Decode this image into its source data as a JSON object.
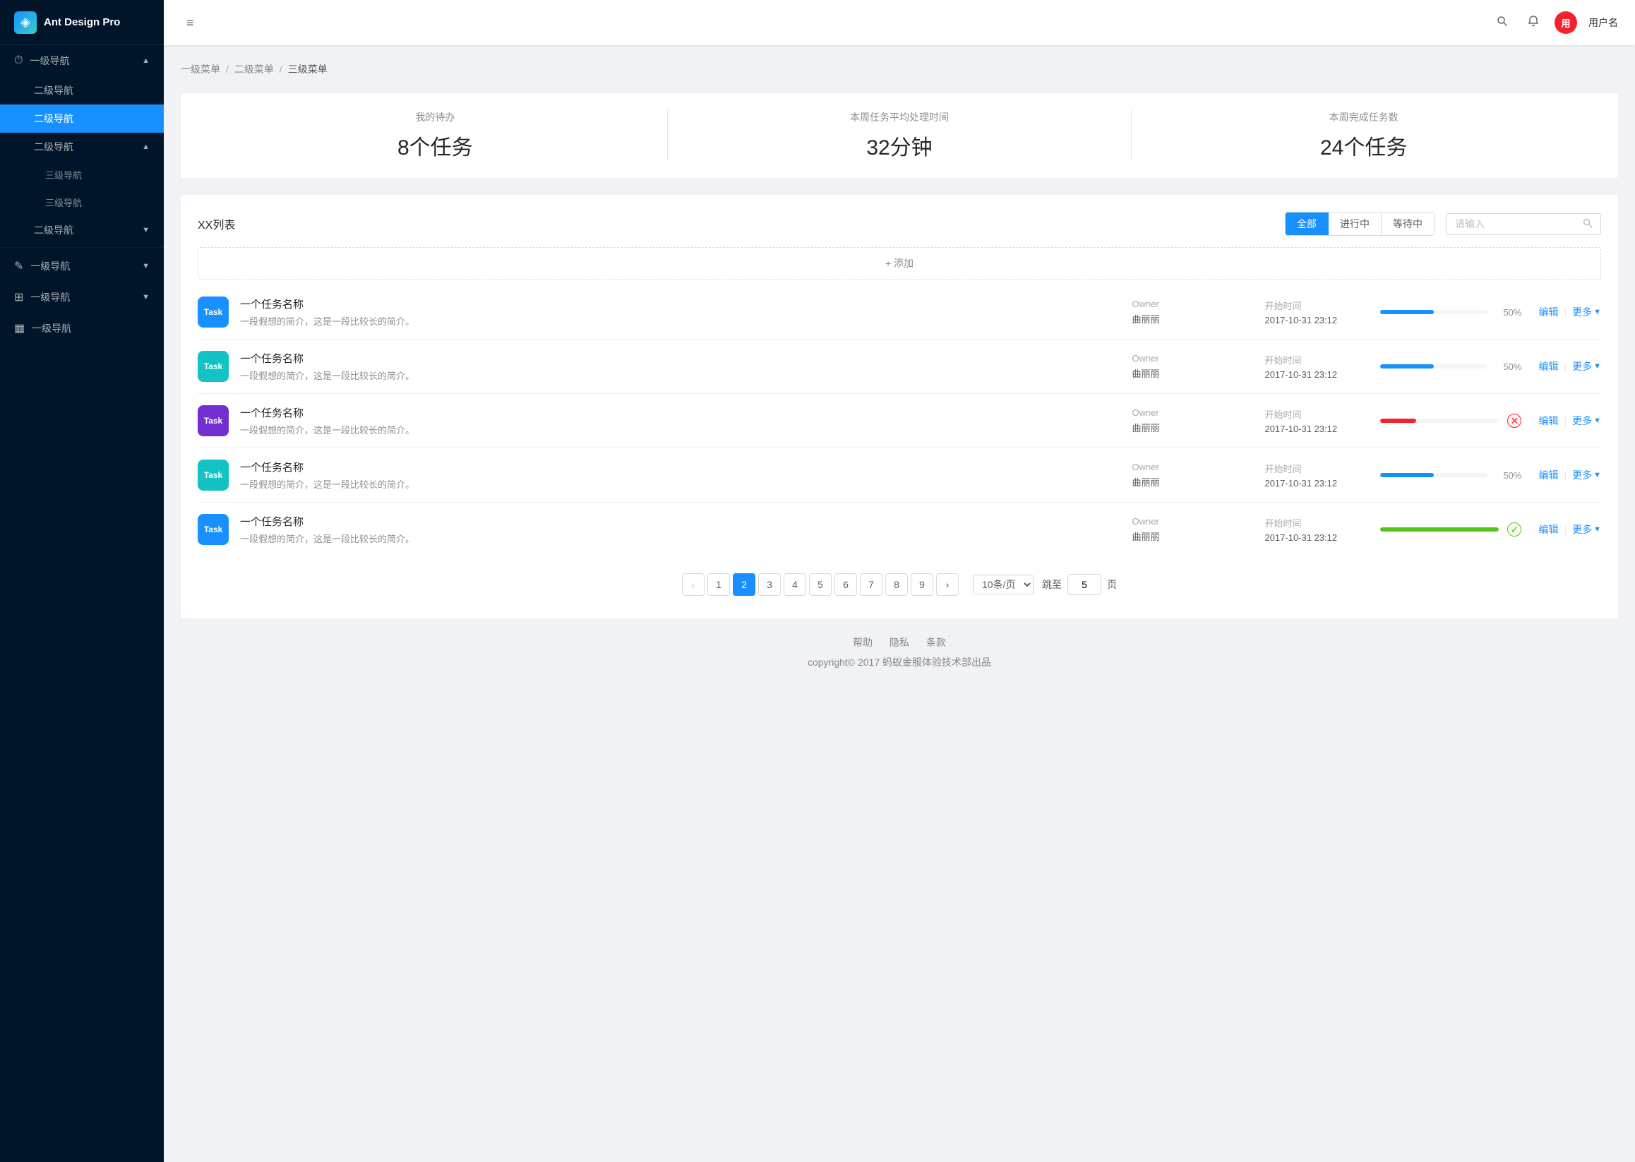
{
  "sidebar": {
    "logo_icon": "◈",
    "logo_title": "Ant Design Pro",
    "nav_items": [
      {
        "id": "nav1",
        "label": "一级导航",
        "level": 1,
        "icon": "⏱",
        "has_arrow": true,
        "expanded": true,
        "active": false
      },
      {
        "id": "nav1-sub1",
        "label": "二级导航",
        "level": 2,
        "has_arrow": false,
        "active": false
      },
      {
        "id": "nav1-sub2",
        "label": "二级导航",
        "level": 2,
        "has_arrow": false,
        "active": true
      },
      {
        "id": "nav2",
        "label": "二级导航",
        "level": 2,
        "has_arrow": true,
        "expanded": true,
        "active": false
      },
      {
        "id": "nav2-sub1",
        "label": "三级导航",
        "level": 3,
        "active": false
      },
      {
        "id": "nav2-sub2",
        "label": "三级导航",
        "level": 3,
        "active": false
      },
      {
        "id": "nav3",
        "label": "二级导航",
        "level": 2,
        "has_arrow": true,
        "active": false
      },
      {
        "id": "nav4",
        "label": "一级导航",
        "level": 1,
        "icon": "✎",
        "has_arrow": true,
        "active": false
      },
      {
        "id": "nav5",
        "label": "一级导航",
        "level": 1,
        "icon": "⊞",
        "has_arrow": true,
        "active": false
      },
      {
        "id": "nav6",
        "label": "一级导航",
        "level": 1,
        "icon": "▦",
        "has_arrow": false,
        "active": false
      }
    ]
  },
  "header": {
    "menu_toggle": "≡",
    "search_placeholder": "搜索",
    "bell_icon": "🔔",
    "user_avatar_text": "用",
    "user_name": "用户名"
  },
  "breadcrumb": {
    "items": [
      "一级菜单",
      "二级菜单",
      "三级菜单"
    ],
    "separator": "/"
  },
  "stats": [
    {
      "label": "我的待办",
      "value": "8个任务"
    },
    {
      "label": "本周任务平均处理时间",
      "value": "32分钟"
    },
    {
      "label": "本周完成任务数",
      "value": "24个任务"
    }
  ],
  "task_list": {
    "title": "XX列表",
    "filter_buttons": [
      {
        "id": "all",
        "label": "全部",
        "active": true
      },
      {
        "id": "inprogress",
        "label": "进行中",
        "active": false
      },
      {
        "id": "waiting",
        "label": "等待中",
        "active": false
      }
    ],
    "search_placeholder": "请输入",
    "add_label": "+ 添加",
    "tasks": [
      {
        "id": 1,
        "badge_text": "Task",
        "badge_color": "blue",
        "name": "一个任务名称",
        "desc": "一段假想的简介，这是一段比较长的简介。",
        "owner_label": "Owner",
        "owner_value": "曲丽丽",
        "time_label": "开始时间",
        "time_value": "2017-10-31 23:12",
        "progress": 50,
        "progress_color": "blue",
        "progress_pct": "50%",
        "status": "normal"
      },
      {
        "id": 2,
        "badge_text": "Task",
        "badge_color": "cyan",
        "name": "一个任务名称",
        "desc": "一段假想的简介，这是一段比较长的简介。",
        "owner_label": "Owner",
        "owner_value": "曲丽丽",
        "time_label": "开始时间",
        "time_value": "2017-10-31 23:12",
        "progress": 50,
        "progress_color": "blue",
        "progress_pct": "50%",
        "status": "normal"
      },
      {
        "id": 3,
        "badge_text": "Task",
        "badge_color": "purple",
        "name": "一个任务名称",
        "desc": "一段假想的简介，这是一段比较长的简介。",
        "owner_label": "Owner",
        "owner_value": "曲丽丽",
        "time_label": "开始时间",
        "time_value": "2017-10-31 23:12",
        "progress": 30,
        "progress_color": "red",
        "progress_pct": "",
        "status": "error"
      },
      {
        "id": 4,
        "badge_text": "Task",
        "badge_color": "cyan",
        "name": "一个任务名称",
        "desc": "一段假想的简介，这是一段比较长的简介。",
        "owner_label": "Owner",
        "owner_value": "曲丽丽",
        "time_label": "开始时间",
        "time_value": "2017-10-31 23:12",
        "progress": 50,
        "progress_color": "blue",
        "progress_pct": "50%",
        "status": "normal"
      },
      {
        "id": 5,
        "badge_text": "Task",
        "badge_color": "blue",
        "name": "一个任务名称",
        "desc": "一段假想的简介，这是一段比较长的简介。",
        "owner_label": "Owner",
        "owner_value": "曲丽丽",
        "time_label": "开始时间",
        "time_value": "2017-10-31 23:12",
        "progress": 100,
        "progress_color": "green",
        "progress_pct": "",
        "status": "success"
      }
    ],
    "actions": {
      "edit": "编辑",
      "more": "更多"
    }
  },
  "pagination": {
    "prev": "‹",
    "next": "›",
    "pages": [
      "1",
      "2",
      "3",
      "4",
      "5",
      "6",
      "7",
      "8",
      "9"
    ],
    "current_page": "2",
    "page_size_label": "10条/页",
    "jump_label": "跳至",
    "jump_suffix": "页",
    "jump_value": "5"
  },
  "footer": {
    "links": [
      "帮助",
      "隐私",
      "条款"
    ],
    "copyright": "copyright© 2017 蚂蚁金服体验技术部出品"
  }
}
